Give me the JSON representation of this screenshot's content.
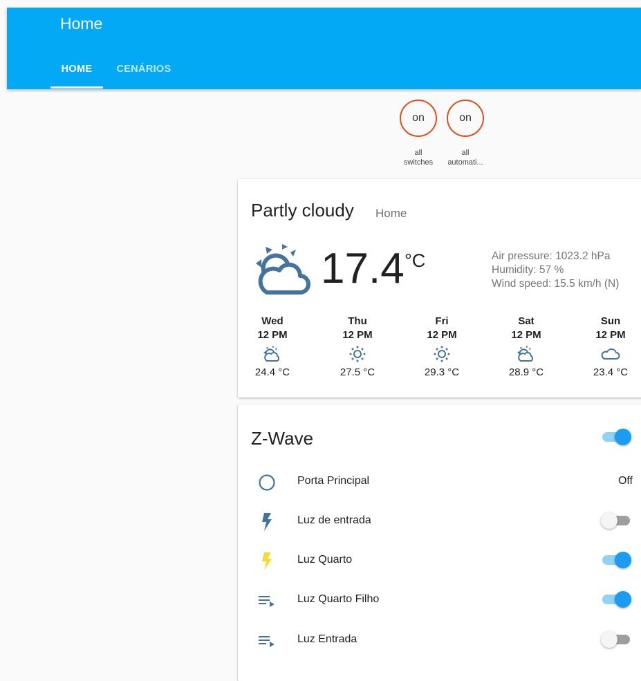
{
  "header": {
    "title": "Home",
    "tabs": [
      {
        "label": "HOME",
        "active": true
      },
      {
        "label": "CENÁRIOS",
        "active": false
      }
    ]
  },
  "badges": [
    {
      "state": "on",
      "label_line1": "all",
      "label_line2": "switches"
    },
    {
      "state": "on",
      "label_line1": "all",
      "label_line2": "automati..."
    }
  ],
  "weather": {
    "condition": "Partly cloudy",
    "name": "Home",
    "temperature": "17.4",
    "unit": "°C",
    "icon": "partly-cloudy-icon",
    "attributes": {
      "pressure": "Air pressure: 1023.2 hPa",
      "humidity": "Humidity: 57 %",
      "wind": "Wind speed: 15.5 km/h (N)"
    },
    "forecast": [
      {
        "day": "Wed",
        "time": "12 PM",
        "icon": "partly-cloudy-icon",
        "temp": "24.4 °C"
      },
      {
        "day": "Thu",
        "time": "12 PM",
        "icon": "sunny-icon",
        "temp": "27.5 °C"
      },
      {
        "day": "Fri",
        "time": "12 PM",
        "icon": "sunny-icon",
        "temp": "29.3 °C"
      },
      {
        "day": "Sat",
        "time": "12 PM",
        "icon": "partly-cloudy-icon",
        "temp": "28.9 °C"
      },
      {
        "day": "Sun",
        "time": "12 PM",
        "icon": "cloudy-icon",
        "temp": "23.4 °C"
      }
    ]
  },
  "zwave": {
    "title": "Z-Wave",
    "group_toggle": "on",
    "entities": [
      {
        "label": "Porta Principal",
        "icon": "circle-outline-icon",
        "state": "Off"
      },
      {
        "label": "Luz de entrada",
        "icon": "flash-icon",
        "toggle": "off"
      },
      {
        "label": "Luz Quarto",
        "icon": "flash-icon",
        "toggle": "on"
      },
      {
        "label": "Luz Quarto Filho",
        "icon": "playlist-play-icon",
        "toggle": "on"
      },
      {
        "label": "Luz Entrada",
        "icon": "playlist-play-icon",
        "toggle": "off"
      }
    ]
  },
  "colors": {
    "header_bg": "#03a9f4",
    "badge_border": "#e04f1a",
    "weather_icon": "#44739e",
    "flash_active": "#fdd835",
    "toggle_on": "#1c9cf0"
  }
}
